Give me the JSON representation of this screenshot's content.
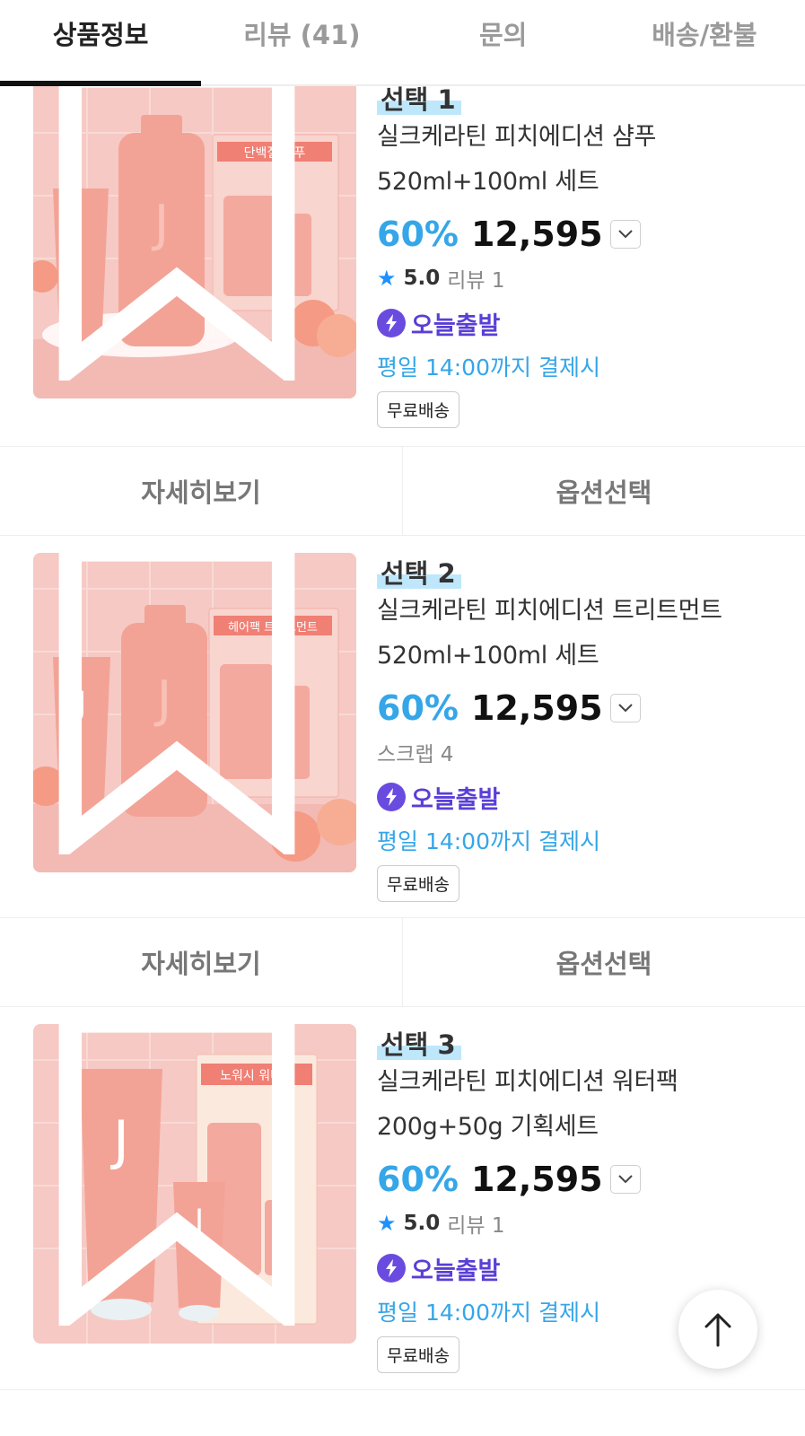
{
  "tabs": [
    {
      "label": "상품정보",
      "active": true
    },
    {
      "label": "리뷰 (41)",
      "active": false
    },
    {
      "label": "문의",
      "active": false
    },
    {
      "label": "배송/환불",
      "active": false
    }
  ],
  "products": [
    {
      "option": "선택 1",
      "name_line1": "실크케라틴 피치에디션 샴푸",
      "name_line2": "520ml+100ml 세트",
      "discount": "60%",
      "price": "12,595",
      "rating": "5.0",
      "review_text": "리뷰 1",
      "today_label": "오늘출발",
      "deadline": "평일 14:00까지 결제시",
      "free_shipping": "무료배송",
      "box_label": "단백질 샴푸"
    },
    {
      "option": "선택 2",
      "name_line1": "실크케라틴 피치에디션 트리트먼트",
      "name_line2": "520ml+100ml 세트",
      "discount": "60%",
      "price": "12,595",
      "scrap_text": "스크랩 4",
      "today_label": "오늘출발",
      "deadline": "평일 14:00까지 결제시",
      "free_shipping": "무료배송",
      "box_label": "헤어팩 트리트먼트"
    },
    {
      "option": "선택 3",
      "name_line1": "실크케라틴 피치에디션 워터팩",
      "name_line2": "200g+50g 기획세트",
      "discount": "60%",
      "price": "12,595",
      "rating": "5.0",
      "review_text": "리뷰 1",
      "today_label": "오늘출발",
      "deadline": "평일 14:00까지 결제시",
      "free_shipping": "무료배송",
      "box_label": "노워시 워터팩"
    }
  ],
  "actions": {
    "detail": "자세히보기",
    "option_select": "옵션선택"
  },
  "colors": {
    "accent_blue": "#35a6e8",
    "today_purple": "#5a3fd6",
    "thumb_pink": "#f7c6c2"
  },
  "icons": [
    "chevron-down-icon",
    "star-icon",
    "bolt-icon",
    "bookmark-icon",
    "arrow-up-icon"
  ]
}
